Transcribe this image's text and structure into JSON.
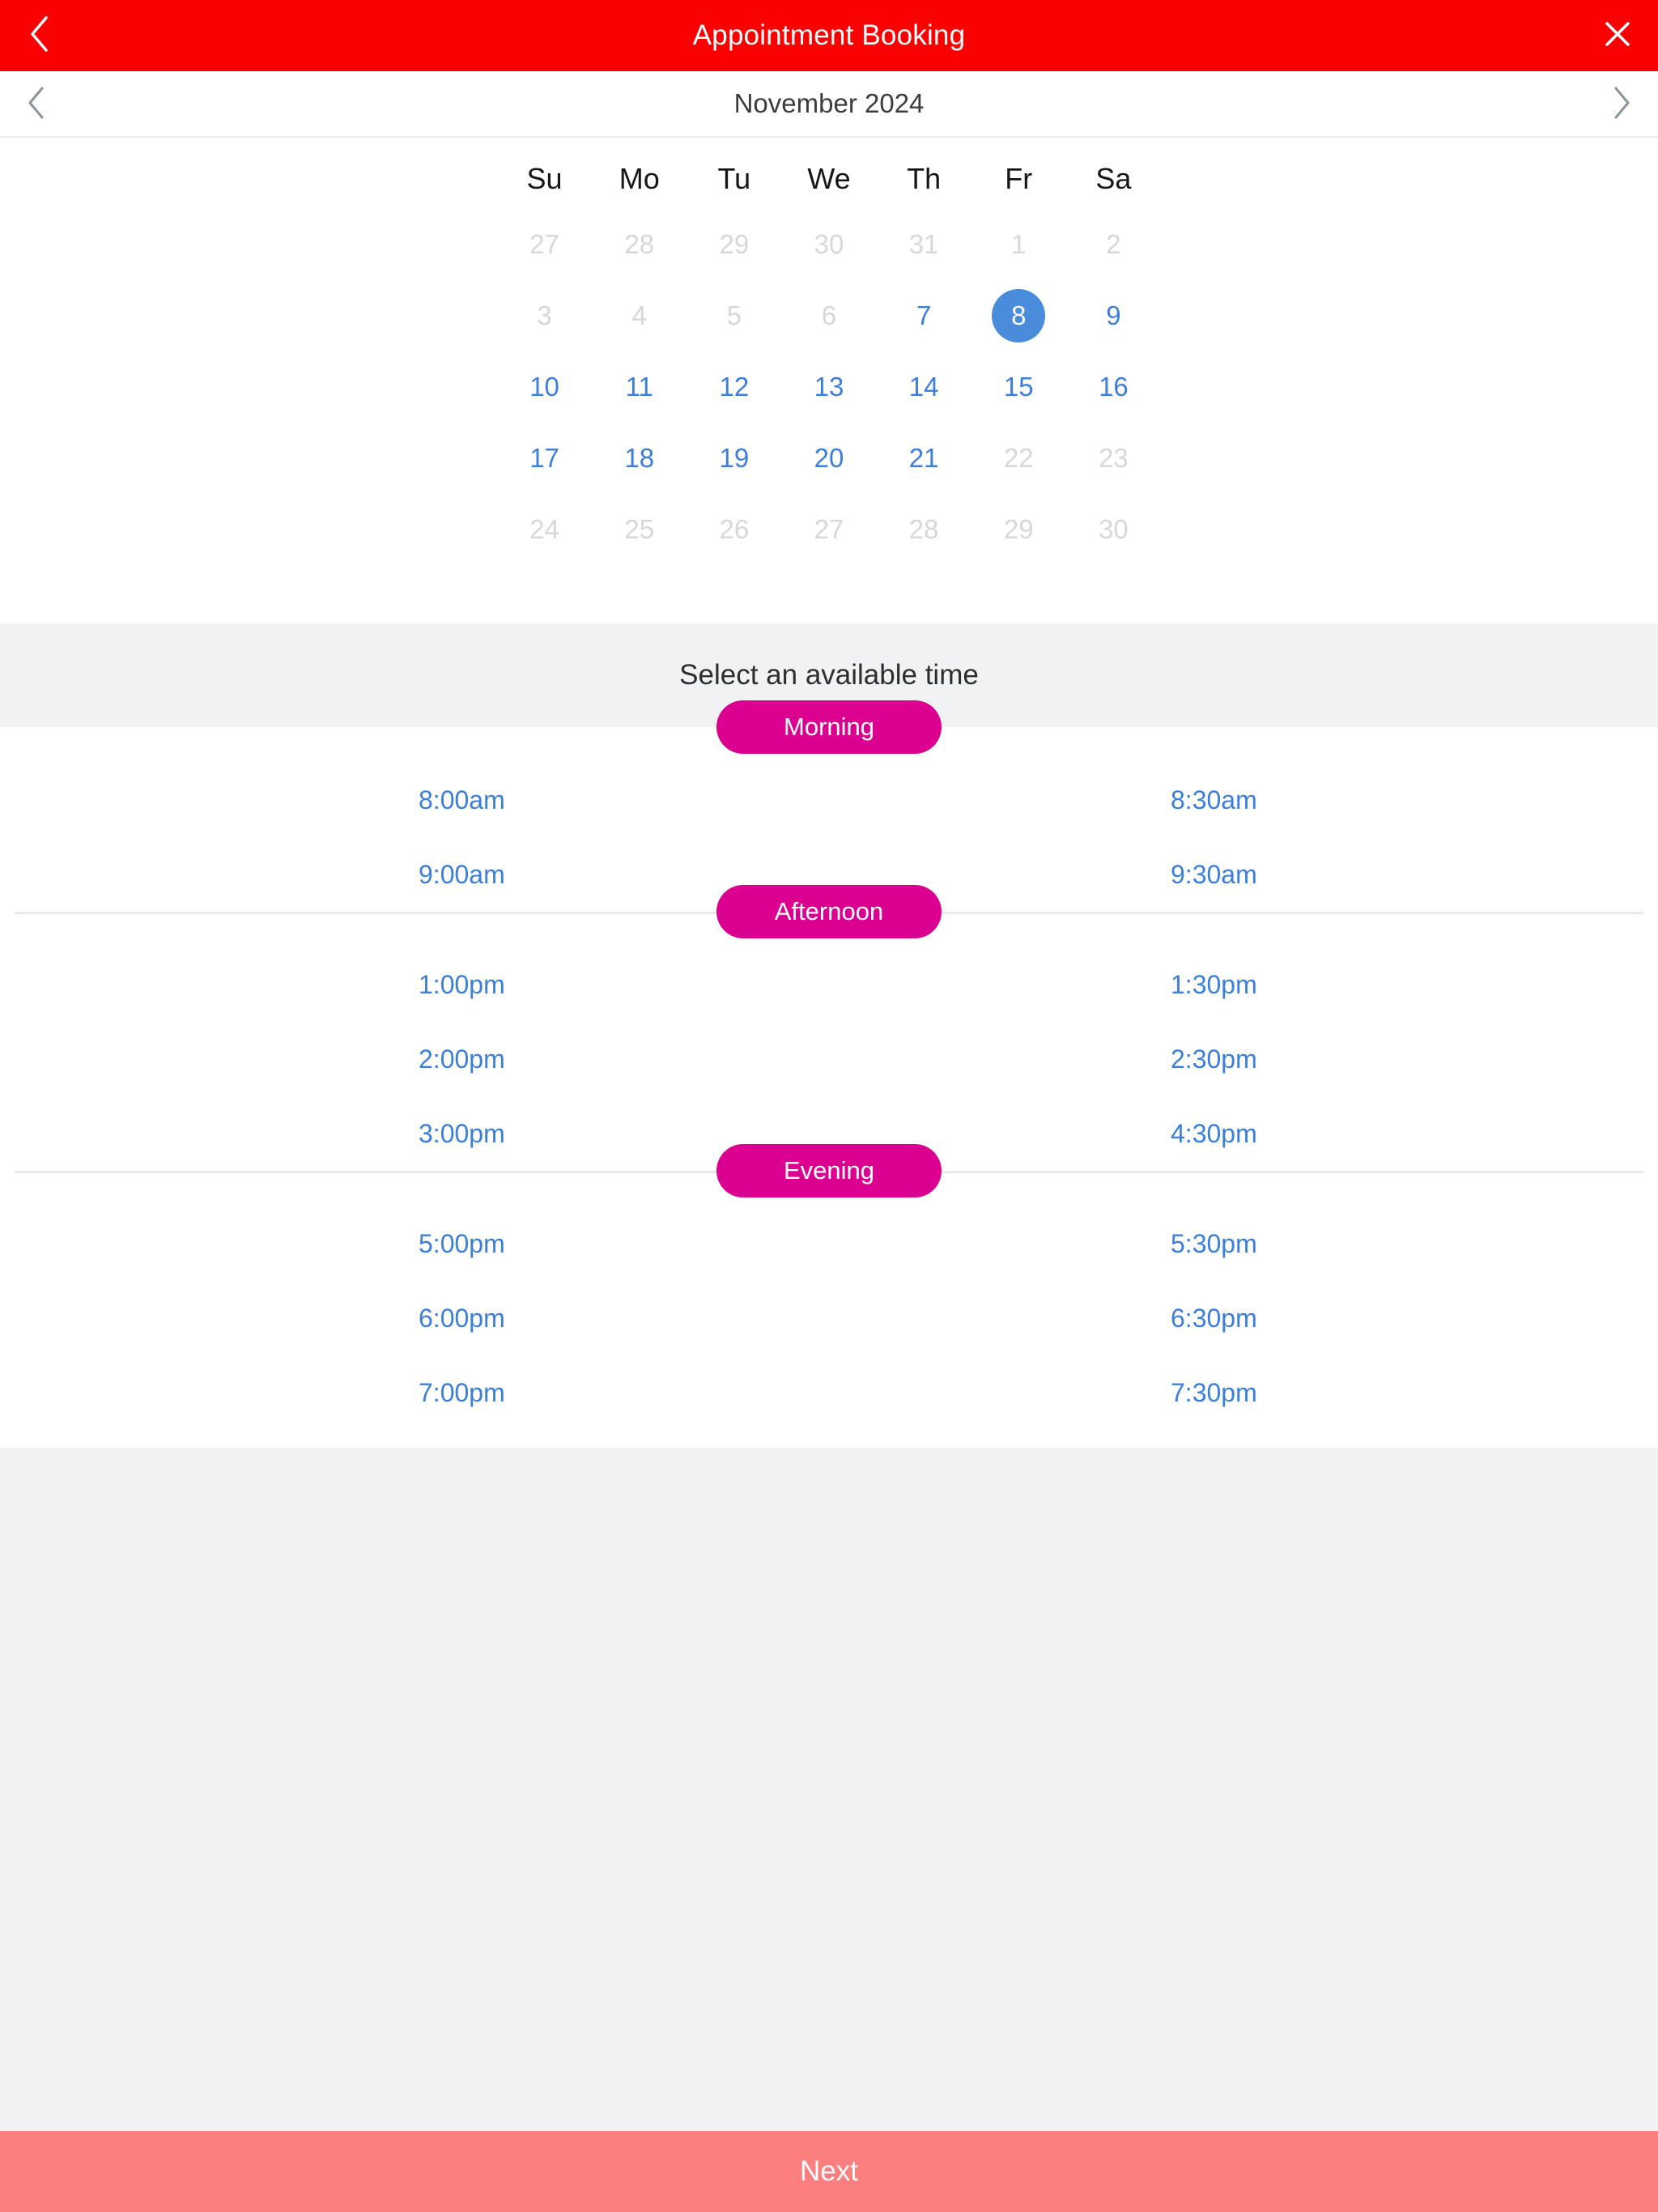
{
  "header": {
    "title": "Appointment Booking",
    "back_icon": "chevron-left-icon",
    "close_icon": "close-icon"
  },
  "month_nav": {
    "prev_icon": "chevron-left-icon",
    "next_icon": "chevron-right-icon",
    "label": "November 2024"
  },
  "calendar": {
    "weekdays": [
      "Su",
      "Mo",
      "Tu",
      "We",
      "Th",
      "Fr",
      "Sa"
    ],
    "selected_day": "8",
    "weeks": [
      [
        {
          "label": "27",
          "state": "muted"
        },
        {
          "label": "28",
          "state": "muted"
        },
        {
          "label": "29",
          "state": "muted"
        },
        {
          "label": "30",
          "state": "muted"
        },
        {
          "label": "31",
          "state": "muted"
        },
        {
          "label": "1",
          "state": "muted"
        },
        {
          "label": "2",
          "state": "muted"
        }
      ],
      [
        {
          "label": "3",
          "state": "muted"
        },
        {
          "label": "4",
          "state": "muted"
        },
        {
          "label": "5",
          "state": "muted"
        },
        {
          "label": "6",
          "state": "muted"
        },
        {
          "label": "7",
          "state": "available"
        },
        {
          "label": "8",
          "state": "selected"
        },
        {
          "label": "9",
          "state": "available"
        }
      ],
      [
        {
          "label": "10",
          "state": "available"
        },
        {
          "label": "11",
          "state": "available"
        },
        {
          "label": "12",
          "state": "available"
        },
        {
          "label": "13",
          "state": "available"
        },
        {
          "label": "14",
          "state": "available"
        },
        {
          "label": "15",
          "state": "available"
        },
        {
          "label": "16",
          "state": "available"
        }
      ],
      [
        {
          "label": "17",
          "state": "available"
        },
        {
          "label": "18",
          "state": "available"
        },
        {
          "label": "19",
          "state": "available"
        },
        {
          "label": "20",
          "state": "available"
        },
        {
          "label": "21",
          "state": "available"
        },
        {
          "label": "22",
          "state": "muted"
        },
        {
          "label": "23",
          "state": "muted"
        }
      ],
      [
        {
          "label": "24",
          "state": "muted"
        },
        {
          "label": "25",
          "state": "muted"
        },
        {
          "label": "26",
          "state": "muted"
        },
        {
          "label": "27",
          "state": "muted"
        },
        {
          "label": "28",
          "state": "muted"
        },
        {
          "label": "29",
          "state": "muted"
        },
        {
          "label": "30",
          "state": "muted"
        }
      ]
    ]
  },
  "time_section": {
    "band_text": "Select an available time",
    "groups": [
      {
        "label": "Morning",
        "rows": [
          {
            "left": "8:00am",
            "right": "8:30am"
          },
          {
            "left": "9:00am",
            "right": "9:30am"
          }
        ]
      },
      {
        "label": "Afternoon",
        "rows": [
          {
            "left": "1:00pm",
            "right": "1:30pm"
          },
          {
            "left": "2:00pm",
            "right": "2:30pm"
          },
          {
            "left": "3:00pm",
            "right": "4:30pm"
          }
        ]
      },
      {
        "label": "Evening",
        "rows": [
          {
            "left": "5:00pm",
            "right": "5:30pm"
          },
          {
            "left": "6:00pm",
            "right": "6:30pm"
          },
          {
            "left": "7:00pm",
            "right": "7:30pm"
          }
        ]
      }
    ]
  },
  "footer": {
    "next_label": "Next"
  },
  "colors": {
    "header_red": "#FB0000",
    "accent_magenta": "#DB0090",
    "link_blue": "#3B7FDB",
    "selected_blue": "#4A8CDC",
    "muted_gray": "#D5D7DA",
    "band_gray": "#F1F2F3",
    "next_button": "#FC7F7F"
  }
}
